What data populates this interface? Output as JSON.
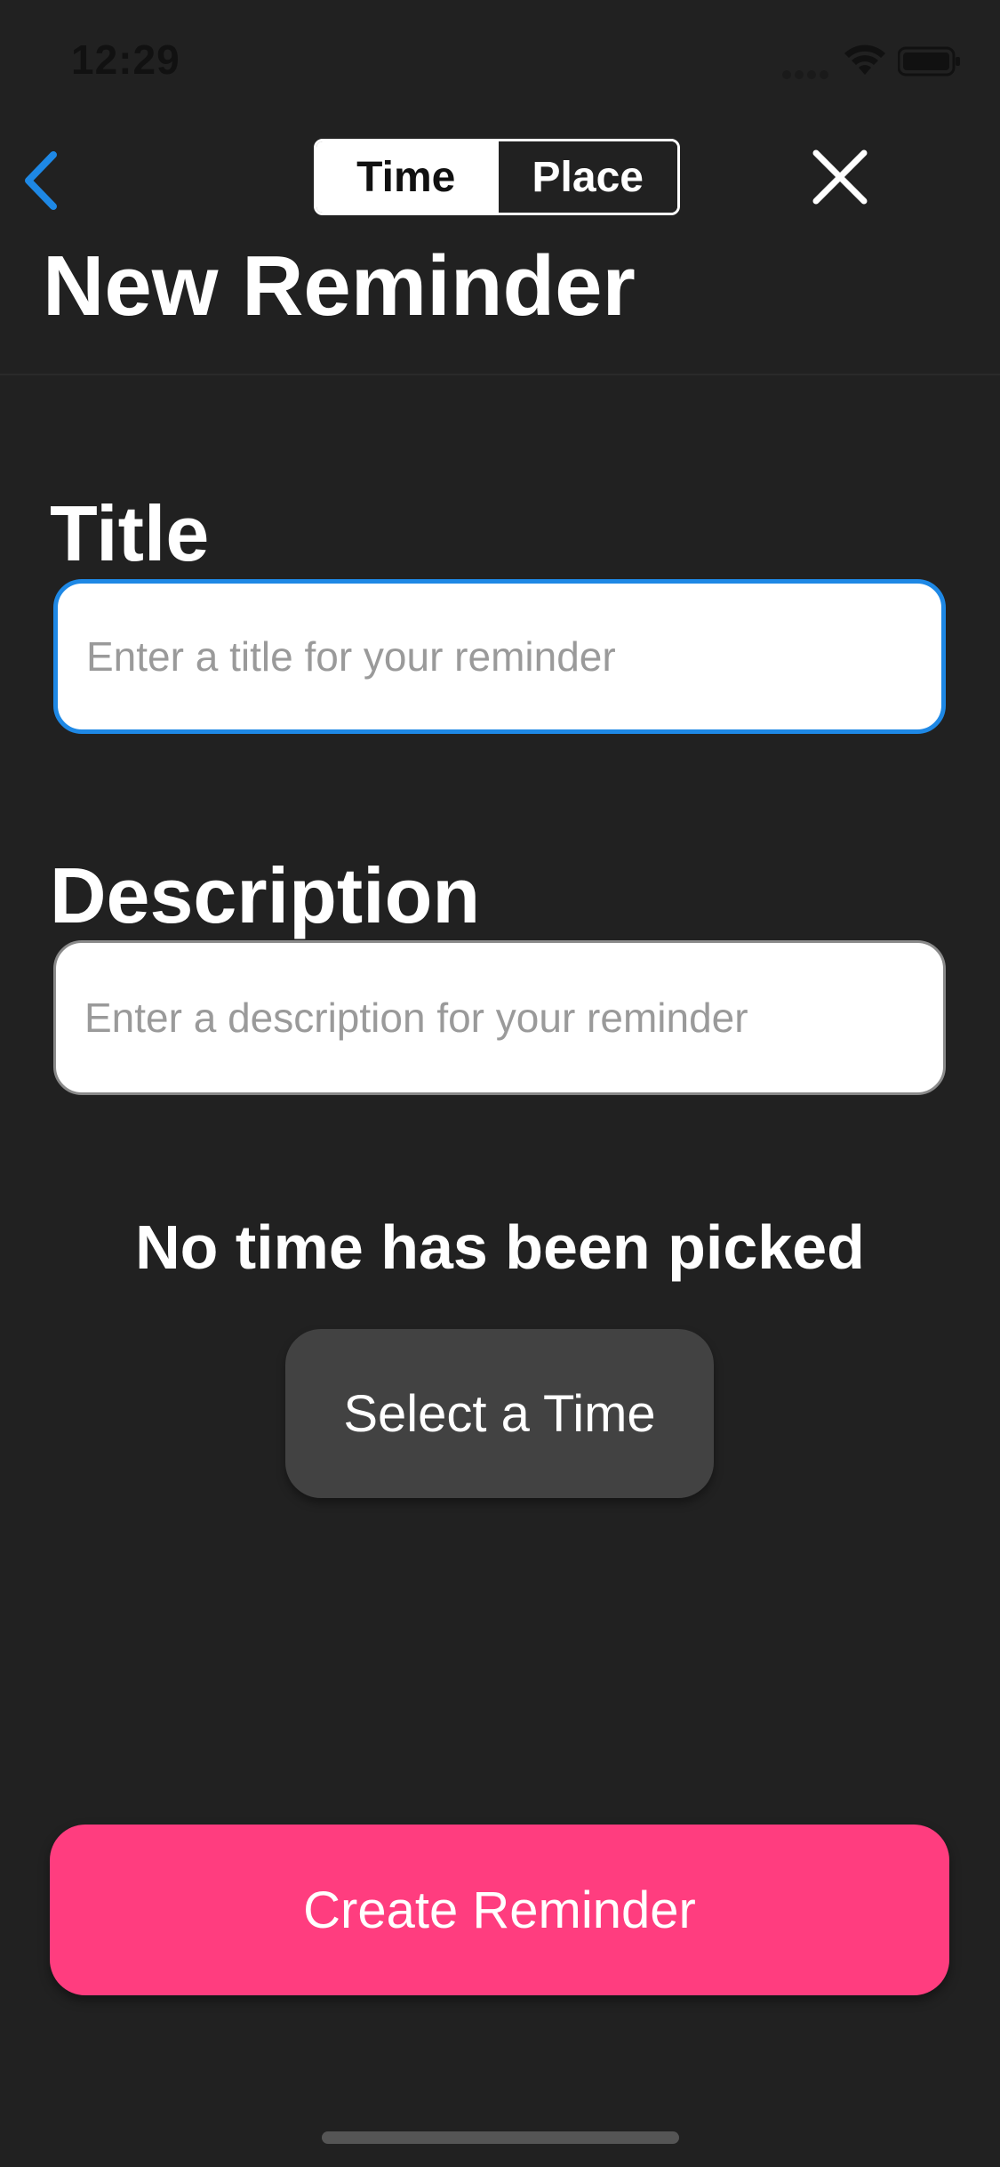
{
  "status_bar": {
    "time": "12:29"
  },
  "nav": {
    "back_icon": "chevron-left-icon",
    "segments": [
      {
        "label": "Time",
        "selected": true
      },
      {
        "label": "Place",
        "selected": false
      }
    ],
    "close_icon": "close-icon",
    "title": "New Reminder"
  },
  "form": {
    "title_label": "Title",
    "title_placeholder": "Enter a title for your reminder",
    "title_value": "",
    "description_label": "Description",
    "description_placeholder": "Enter a description for your reminder",
    "description_value": ""
  },
  "time_picker": {
    "status_text": "No time has been picked",
    "button_label": "Select a Time"
  },
  "actions": {
    "create_label": "Create Reminder"
  },
  "colors": {
    "background": "#212121",
    "accent_blue": "#1e88e5",
    "create_pink": "#ff3d7f",
    "select_button": "#424242"
  }
}
